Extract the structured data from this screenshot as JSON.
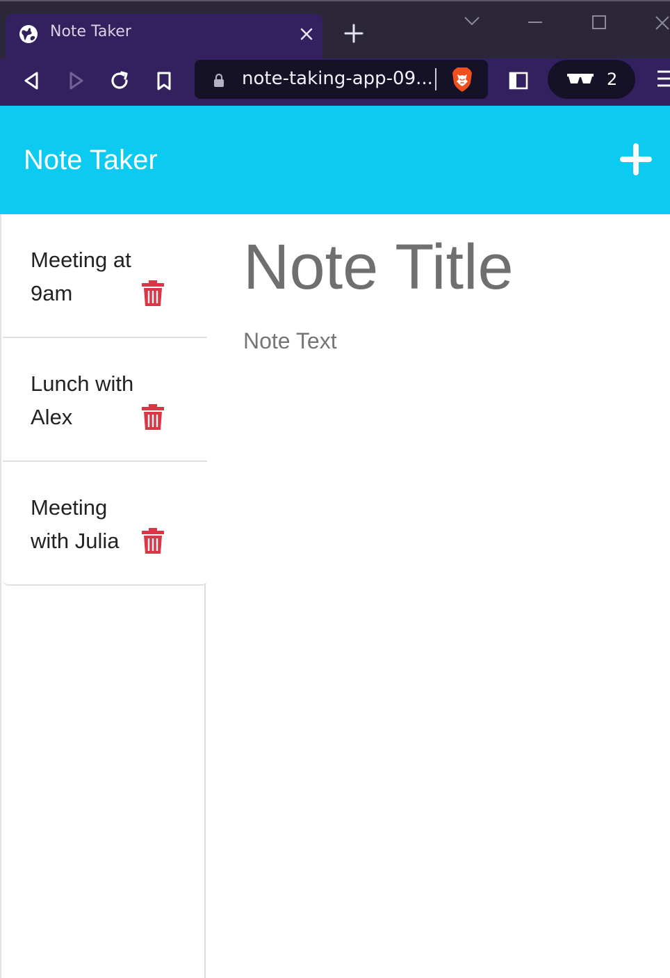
{
  "browser": {
    "tab_title": "Note Taker",
    "url": "note-taking-app-09...",
    "private_tab_count": "2",
    "colors": {
      "tabstrip": "#2b2739",
      "toolbar": "#33205f",
      "urlbar": "#151127",
      "brave_orange": "#f24f1e"
    },
    "icons": [
      "globe-icon",
      "close-tab-icon",
      "new-tab-icon",
      "tab-search-icon",
      "minimize-icon",
      "maximize-icon",
      "window-close-icon",
      "back-icon",
      "forward-icon",
      "reload-icon",
      "bookmark-icon",
      "lock-icon",
      "brave-shields-icon",
      "sidebar-icon",
      "private-glasses-icon",
      "menu-icon"
    ]
  },
  "app": {
    "brand": "Note Taker",
    "colors": {
      "navbar": "#0dcaf0",
      "delete_icon": "#dc3545"
    },
    "notes": [
      {
        "title": "Meeting at 9am"
      },
      {
        "title": "Lunch with Alex"
      },
      {
        "title": "Meeting with Julia"
      }
    ],
    "editor": {
      "title_placeholder": "Note Title",
      "text_placeholder": "Note Text"
    }
  }
}
